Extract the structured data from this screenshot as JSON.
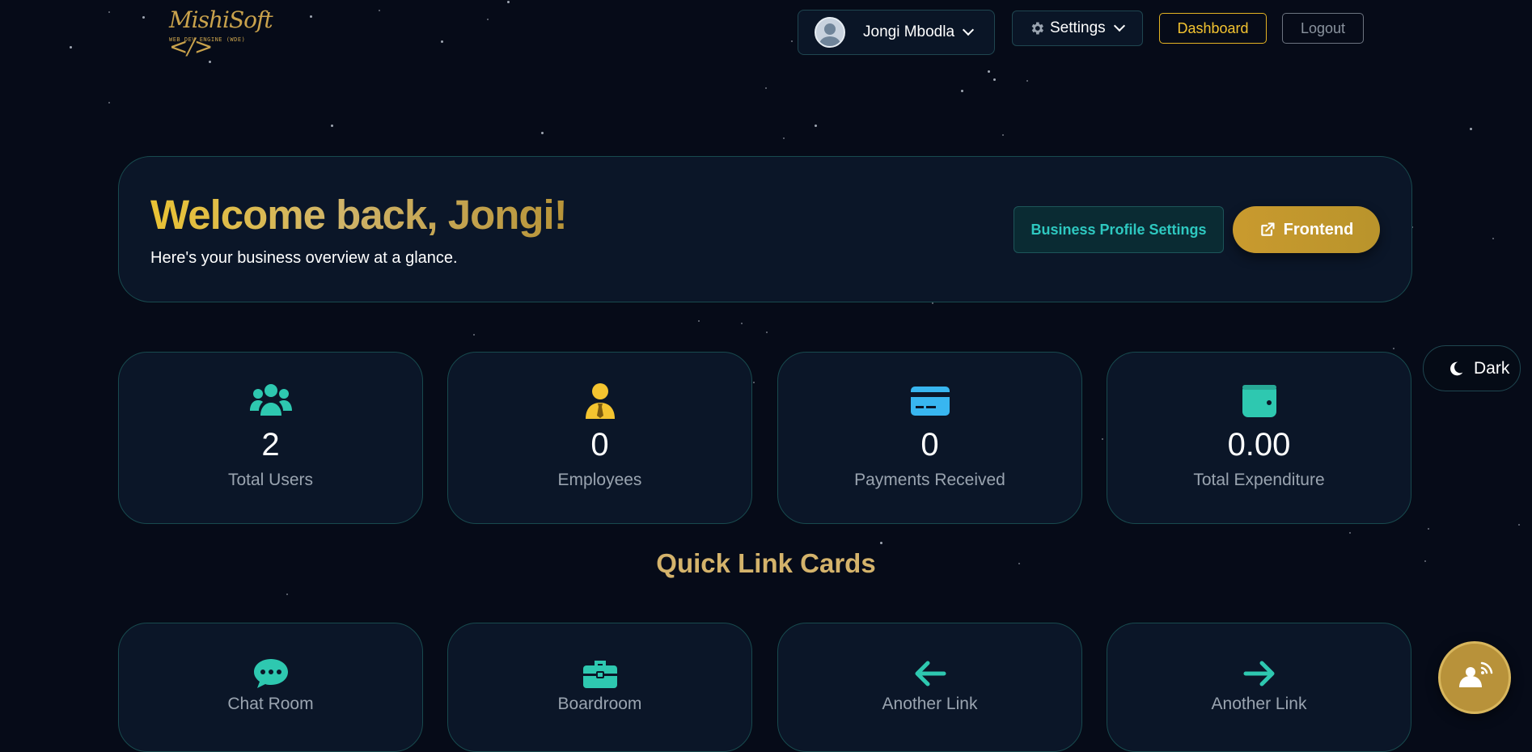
{
  "brand": {
    "logo_text": "MishiSoft </>",
    "logo_subtitle": "WEB DEV ENGINE (WDE)"
  },
  "header": {
    "user_name": "Jongi Mbodla",
    "settings_label": "Settings",
    "dashboard_label": "Dashboard",
    "logout_label": "Logout"
  },
  "welcome": {
    "title": "Welcome back, Jongi!",
    "subtitle": "Here's your business overview at a glance.",
    "business_profile_label": "Business Profile Settings",
    "frontend_label": "Frontend"
  },
  "stats": [
    {
      "icon": "users-icon",
      "value": "2",
      "label": "Total Users",
      "color": "#2ec8b0"
    },
    {
      "icon": "employee-icon",
      "value": "0",
      "label": "Employees",
      "color": "#f4c430"
    },
    {
      "icon": "credit-card-icon",
      "value": "0",
      "label": "Payments Received",
      "color": "#38b6f0"
    },
    {
      "icon": "wallet-icon",
      "value": "0.00",
      "label": "Total Expenditure",
      "color": "#2ec8b0"
    }
  ],
  "theme_toggle": {
    "label": "Dark"
  },
  "quick_links": {
    "title": "Quick Link Cards",
    "items": [
      {
        "icon": "chat-icon",
        "label": "Chat Room"
      },
      {
        "icon": "briefcase-icon",
        "label": "Boardroom"
      },
      {
        "icon": "arrow-left-icon",
        "label": "Another Link"
      },
      {
        "icon": "arrow-right-icon",
        "label": "Another Link"
      }
    ]
  },
  "colors": {
    "background": "#060b18",
    "card": "#0b1628",
    "border": "#184a4e",
    "gold": "#f4c430",
    "teal": "#2ec8b0"
  }
}
